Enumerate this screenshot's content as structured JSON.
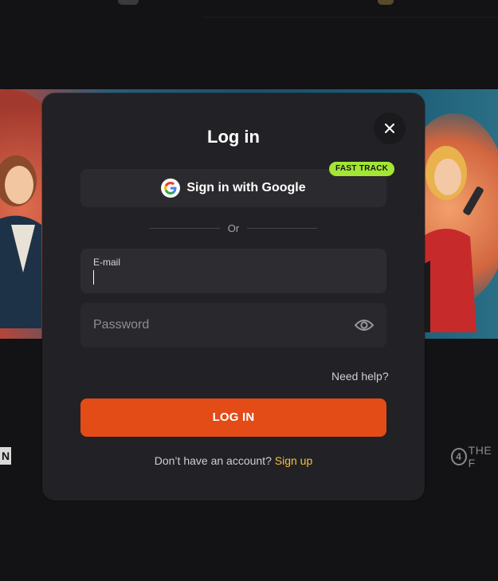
{
  "modal": {
    "title": "Log in",
    "close_icon": "close-icon",
    "google_button_label": "Sign in with Google",
    "fast_track_badge": "FAST TRACK",
    "divider_text": "Or",
    "email": {
      "label": "E-mail",
      "value": ""
    },
    "password": {
      "placeholder": "Password",
      "toggle_icon": "eye-icon"
    },
    "need_help": "Need help?",
    "login_button": "LOG IN",
    "signup_prompt": "Don’t have an account?",
    "signup_link": "Sign up"
  },
  "background": {
    "provider_left": "N",
    "provider_right_mark": "4",
    "provider_right_text": "THE F"
  },
  "colors": {
    "modal_bg": "#222125",
    "primary": "#e34b17",
    "badge": "#a3e635",
    "link": "#f5c242"
  }
}
